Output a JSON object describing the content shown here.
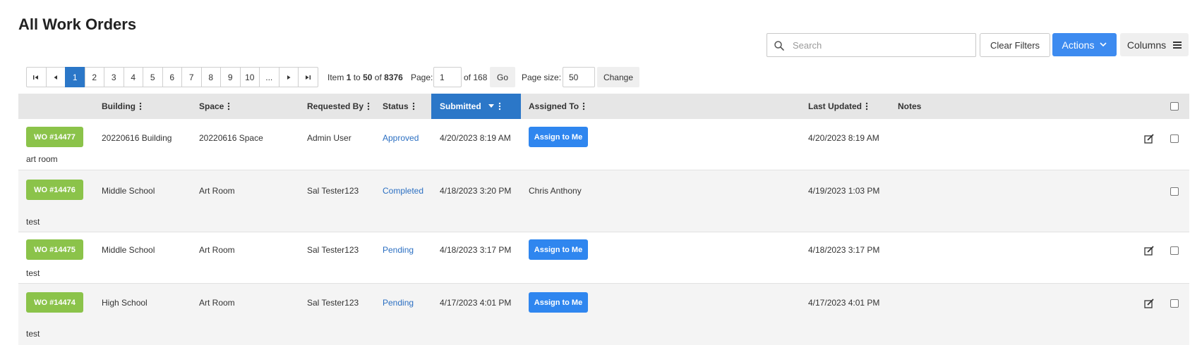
{
  "page": {
    "title": "All Work Orders"
  },
  "toolbar": {
    "search_placeholder": "Search",
    "search_value": "",
    "clear_filters_label": "Clear Filters",
    "actions_label": "Actions",
    "columns_label": "Columns",
    "accent_color": "#3d8bf0"
  },
  "pager": {
    "pages": [
      "1",
      "2",
      "3",
      "4",
      "5",
      "6",
      "7",
      "8",
      "9",
      "10",
      "..."
    ],
    "active_page": "1",
    "item_prefix": "Item",
    "item_from": "1",
    "item_to_word": "to",
    "item_to": "50",
    "item_of_word": "of",
    "item_total": "8376",
    "page_label": "Page:",
    "page_value": "1",
    "page_of": "of 168",
    "go_label": "Go",
    "size_label": "Page size:",
    "size_value": "50",
    "change_label": "Change"
  },
  "columns": {
    "building": "Building",
    "space": "Space",
    "requested_by": "Requested By",
    "status": "Status",
    "submitted": "Submitted",
    "assigned_to": "Assigned To",
    "last_updated": "Last Updated",
    "notes": "Notes"
  },
  "rows": [
    {
      "wo": "WO #14477",
      "building": "20220616 Building",
      "space": "20220616 Space",
      "requested_by": "Admin User",
      "status": "Approved",
      "submitted": "4/20/2023 8:19 AM",
      "assigned_to": "",
      "assign_label": "Assign to Me",
      "last_updated": "4/20/2023 8:19 AM",
      "notes": "art room"
    },
    {
      "wo": "WO #14476",
      "building": "Middle School",
      "space": "Art Room",
      "requested_by": "Sal Tester123",
      "status": "Completed",
      "submitted": "4/18/2023 3:20 PM",
      "assigned_to": "Chris Anthony",
      "assign_label": "",
      "last_updated": "4/19/2023 1:03 PM",
      "notes": "test"
    },
    {
      "wo": "WO #14475",
      "building": "Middle School",
      "space": "Art Room",
      "requested_by": "Sal Tester123",
      "status": "Pending",
      "submitted": "4/18/2023 3:17 PM",
      "assigned_to": "",
      "assign_label": "Assign to Me",
      "last_updated": "4/18/2023 3:17 PM",
      "notes": "test"
    },
    {
      "wo": "WO #14474",
      "building": "High School",
      "space": "Art Room",
      "requested_by": "Sal Tester123",
      "status": "Pending",
      "submitted": "4/17/2023 4:01 PM",
      "assigned_to": "",
      "assign_label": "Assign to Me",
      "last_updated": "4/17/2023 4:01 PM",
      "notes": "test"
    }
  ],
  "colors": {
    "badge_green": "#8bc34a",
    "sorted_header": "#2b77c8",
    "status_link": "#2b6fc2"
  }
}
